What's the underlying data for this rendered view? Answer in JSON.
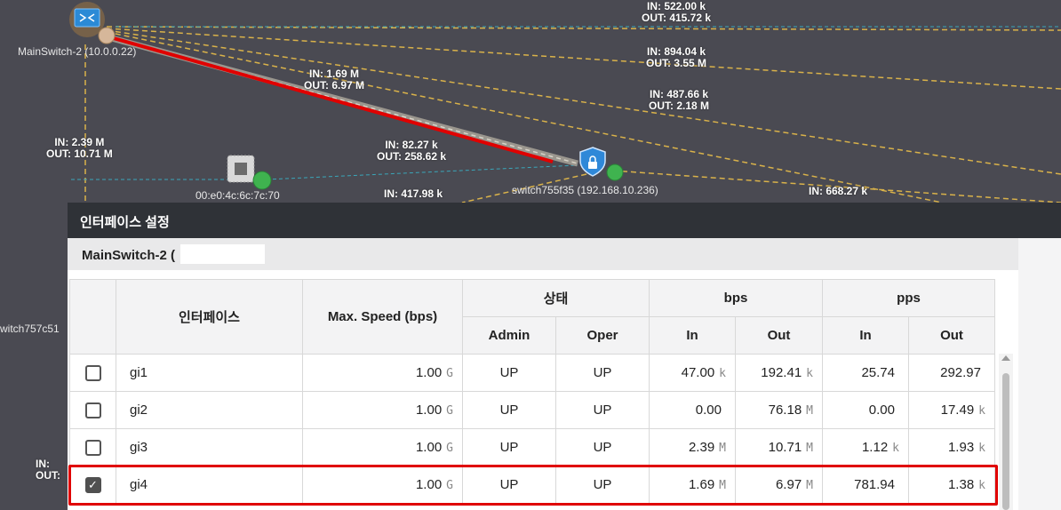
{
  "topology": {
    "nodes": {
      "main_switch": "MainSwitch-2 (10.0.0.22)",
      "switch755": "switch755f35 (192.168.10.236)",
      "mac_node": "00:e0:4c:6c:7c:70",
      "switch757": "witch757c51"
    },
    "link_labels": [
      {
        "in": "IN: 522.00 k",
        "out": "OUT: 415.72 k"
      },
      {
        "in": "IN: 894.04 k",
        "out": "OUT: 3.55 M"
      },
      {
        "in": "IN: 487.66 k",
        "out": "OUT: 2.18 M"
      },
      {
        "in": "IN: 1.69 M",
        "out": "OUT: 6.97 M"
      },
      {
        "in": "IN: 2.39 M",
        "out": "OUT: 10.71 M"
      },
      {
        "in": "IN: 82.27 k",
        "out": "OUT: 258.62 k"
      },
      {
        "in": "IN: 417.98 k",
        "out": ""
      },
      {
        "in": "IN: 668.27 k",
        "out": ""
      },
      {
        "in": "IN:",
        "out": "OUT:"
      }
    ],
    "colors": {
      "dashed_link": "#d9b24a",
      "teal_link": "#3aa6b9",
      "highlight": "#e00000",
      "node_green": "#3fb34f"
    },
    "icons": [
      "switch-icon",
      "shield-lock-icon",
      "chip-icon",
      "status-ball-icon"
    ]
  },
  "dialog": {
    "title": "인터페이스 설정",
    "device": "MainSwitch-2 (",
    "headers": {
      "interface": "인터페이스",
      "max_speed": "Max. Speed (bps)",
      "status": "상태",
      "admin": "Admin",
      "oper": "Oper",
      "bps": "bps",
      "pps": "pps",
      "in": "In",
      "out": "Out"
    },
    "rows": [
      {
        "checked": false,
        "name": "gi1",
        "speed": "1.00",
        "speed_unit": "G",
        "admin": "UP",
        "oper": "UP",
        "bps_in": "47.00",
        "bps_in_unit": "k",
        "bps_out": "192.41",
        "bps_out_unit": "k",
        "pps_in": "25.74",
        "pps_in_unit": "",
        "pps_out": "292.97",
        "pps_out_unit": ""
      },
      {
        "checked": false,
        "name": "gi2",
        "speed": "1.00",
        "speed_unit": "G",
        "admin": "UP",
        "oper": "UP",
        "bps_in": "0.00",
        "bps_in_unit": "",
        "bps_out": "76.18",
        "bps_out_unit": "M",
        "pps_in": "0.00",
        "pps_in_unit": "",
        "pps_out": "17.49",
        "pps_out_unit": "k"
      },
      {
        "checked": false,
        "name": "gi3",
        "speed": "1.00",
        "speed_unit": "G",
        "admin": "UP",
        "oper": "UP",
        "bps_in": "2.39",
        "bps_in_unit": "M",
        "bps_out": "10.71",
        "bps_out_unit": "M",
        "pps_in": "1.12",
        "pps_in_unit": "k",
        "pps_out": "1.93",
        "pps_out_unit": "k"
      },
      {
        "checked": true,
        "name": "gi4",
        "speed": "1.00",
        "speed_unit": "G",
        "admin": "UP",
        "oper": "UP",
        "bps_in": "1.69",
        "bps_in_unit": "M",
        "bps_out": "6.97",
        "bps_out_unit": "M",
        "pps_in": "781.94",
        "pps_in_unit": "",
        "pps_out": "1.38",
        "pps_out_unit": "k"
      }
    ]
  }
}
